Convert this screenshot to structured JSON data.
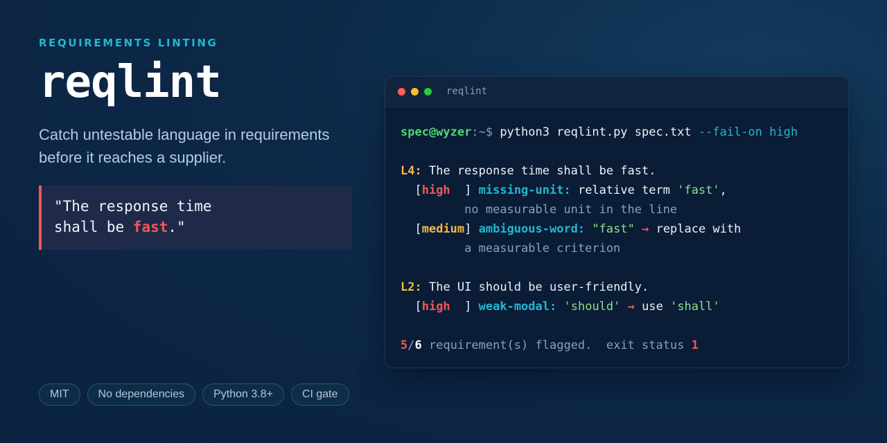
{
  "hero": {
    "eyebrow": "REQUIREMENTS LINTING",
    "title": "reqlint",
    "tagline": "Catch untestable language in requirements before it reaches a supplier.",
    "quote_line1": "\"The response time",
    "quote_line2_before": "shall be ",
    "quote_highlight": "fast",
    "quote_line2_after": ".\""
  },
  "badges": [
    "MIT",
    "No dependencies",
    "Python 3.8+",
    "CI gate"
  ],
  "terminal": {
    "window_title": "reqlint",
    "prompt_user": "spec@wyzer",
    "prompt_path": ":~$ ",
    "command": "python3 reqlint.py spec.txt ",
    "command_flag": "--fail-on",
    "command_arg": " high",
    "findings": [
      {
        "line_no": "L4",
        "text": " The response time shall be fast.",
        "issues": [
          {
            "severity": "high",
            "severity_pad": "  ",
            "rule": "missing-unit",
            "msg1_a": " relative term ",
            "msg1_str": "'fast'",
            "msg1_b": ",",
            "msg2": "no measurable unit in the line"
          },
          {
            "severity": "medium",
            "severity_pad": "",
            "rule": "ambiguous-word",
            "msg1_str": "\"fast\"",
            "msg1_arrow": "→",
            "msg1_b": " replace with",
            "msg2": "a measurable criterion"
          }
        ]
      },
      {
        "line_no": "L2",
        "text": " The UI should be user-friendly.",
        "issues": [
          {
            "severity": "high",
            "severity_pad": "  ",
            "rule": "weak-modal",
            "msg1_str": "'should'",
            "msg1_arrow": "→",
            "msg1_b": " use ",
            "msg1_str2": "'shall'"
          }
        ]
      }
    ],
    "summary": {
      "flagged": "5",
      "total": "6",
      "text": " requirement(s) flagged.  exit status ",
      "exit_code": "1"
    }
  }
}
